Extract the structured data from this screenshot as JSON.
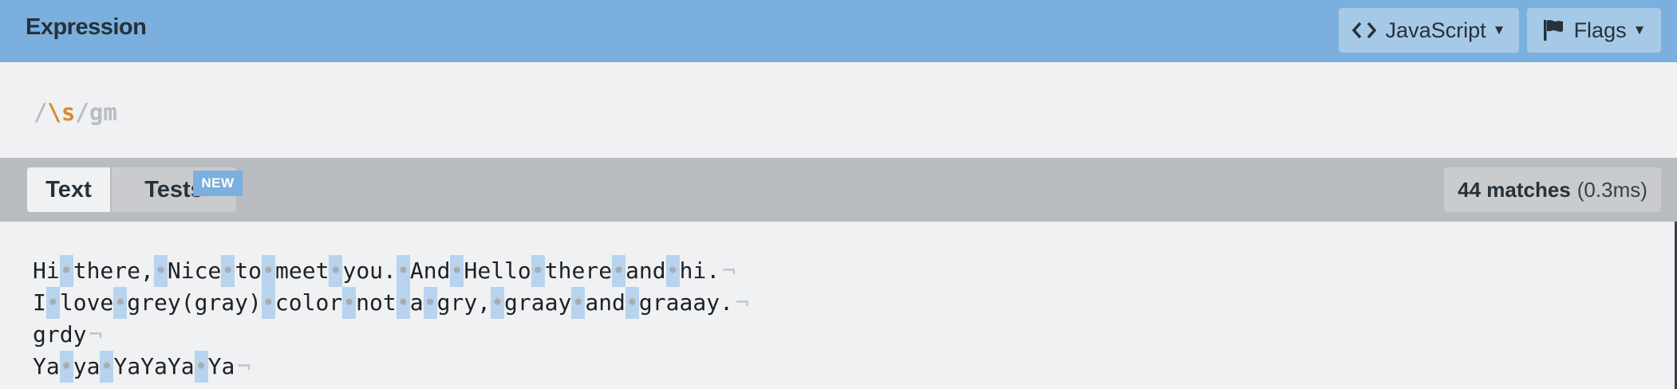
{
  "header": {
    "title": "Expression",
    "language_button": {
      "label": "JavaScript",
      "icon": "code-icon"
    },
    "flags_button": {
      "label": "Flags",
      "icon": "flag-icon"
    }
  },
  "expression": {
    "open_delim": "/",
    "pattern": "\\s",
    "close_delim": "/",
    "flags": "gm"
  },
  "tabs": {
    "text_label": "Text",
    "tests_label": "Tests",
    "new_badge": "NEW"
  },
  "match_info": {
    "count": "44 matches",
    "time": "(0.3ms)"
  },
  "test_text": {
    "lines": [
      [
        "Hi",
        "there,",
        "Nice",
        "to",
        "meet",
        "you.",
        "And",
        "Hello",
        "there",
        "and",
        "hi."
      ],
      [
        "I",
        "love",
        "grey(gray)",
        "color",
        "not",
        "a",
        "gry,",
        "graay",
        "and",
        "graaay."
      ],
      [
        "grdy"
      ],
      [
        "Ya",
        "ya",
        "YaYaYa",
        "Ya"
      ]
    ],
    "space_marker": "•",
    "newline_marker": "¬"
  },
  "colors": {
    "header_bg": "#7bafdd",
    "match_highlight": "#b8d3ee",
    "token_orange": "#d98a2b"
  }
}
